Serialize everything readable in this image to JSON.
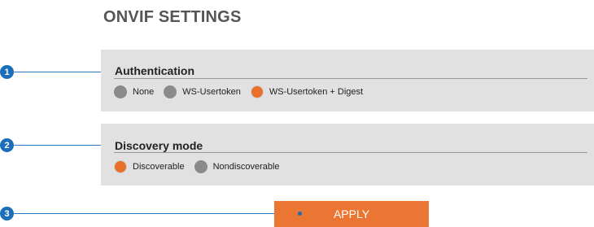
{
  "page": {
    "title": "ONVIF SETTINGS"
  },
  "authentication": {
    "title": "Authentication",
    "options": [
      {
        "label": "None",
        "selected": false
      },
      {
        "label": "WS-Usertoken",
        "selected": false
      },
      {
        "label": "WS-Usertoken + Digest",
        "selected": true
      }
    ]
  },
  "discovery": {
    "title": "Discovery mode",
    "options": [
      {
        "label": "Discoverable",
        "selected": true
      },
      {
        "label": "Nondiscoverable",
        "selected": false
      }
    ]
  },
  "apply_label": "APPLY",
  "markers": [
    "1",
    "2",
    "3"
  ],
  "colors": {
    "accent": "#eb7533",
    "marker": "#1b6fb8",
    "panel": "#e1e1e1",
    "radio_off": "#8a8a8a"
  }
}
